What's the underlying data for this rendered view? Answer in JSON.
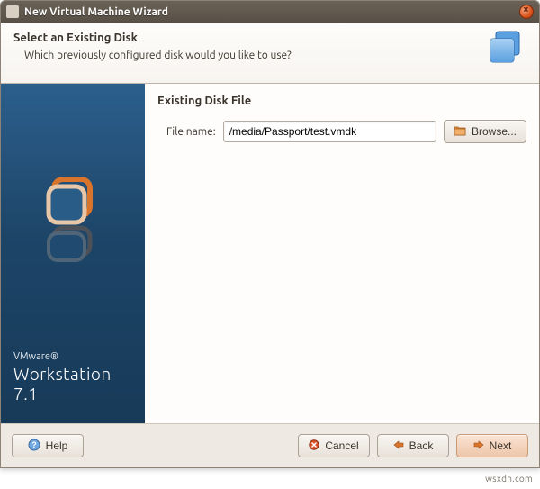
{
  "window": {
    "title": "New Virtual Machine Wizard"
  },
  "header": {
    "title": "Select an Existing Disk",
    "subtitle": "Which previously configured disk would you like to use?"
  },
  "sidebar": {
    "brand_small": "VMware®",
    "brand_large": "Workstation 7.1"
  },
  "main": {
    "section_title": "Existing Disk File",
    "file_label": "File name:",
    "file_value": "/media/Passport/test.vmdk",
    "browse_label": "Browse..."
  },
  "footer": {
    "help": "Help",
    "cancel": "Cancel",
    "back": "Back",
    "next": "Next"
  },
  "watermark": "wsxdn.com"
}
